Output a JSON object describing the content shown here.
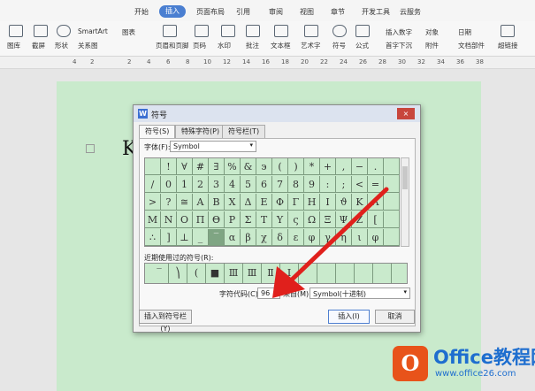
{
  "ribbon_tabs": [
    "开始",
    "插入",
    "页面布局",
    "引用",
    "审阅",
    "视图",
    "章节",
    "开发工具",
    "云服务"
  ],
  "ribbon_groups": {
    "picture": "图库",
    "screenshot": "截屏",
    "shapes": "形状",
    "smartart": "SmartArt",
    "relations": "关系图",
    "chart": "图表",
    "header_footer": "页眉和页脚",
    "page_number": "页码",
    "watermark": "水印",
    "comment": "批注",
    "textbox": "文本框",
    "wordart": "艺术字",
    "symbol": "符号",
    "formula": "公式",
    "insert_number": "插入数字",
    "first_drop": "首字下沉",
    "object": "对象",
    "attachment": "附件",
    "date": "日期",
    "doc_parts": "文档部件",
    "hyperlink": "超链接"
  },
  "ruler_numbers": [
    "4",
    "2",
    "2",
    "4",
    "6",
    "8",
    "10",
    "12",
    "14",
    "16",
    "18",
    "20",
    "22",
    "24",
    "26",
    "28",
    "30",
    "32",
    "34",
    "36",
    "38"
  ],
  "document": {
    "text": "K"
  },
  "dialog": {
    "title": "符号",
    "close_label": "×",
    "tabs": [
      "符号(S)",
      "特殊字符(P)",
      "符号栏(T)"
    ],
    "font_label": "字体(F):",
    "font_value": "Symbol",
    "grid_symbols": [
      [
        "",
        "!",
        "∀",
        "#",
        "∃",
        "%",
        "&",
        "϶",
        "(",
        ")",
        "*",
        "+",
        ",",
        "−",
        ".",
        ""
      ],
      [
        "/",
        "0",
        "1",
        "2",
        "3",
        "4",
        "5",
        "6",
        "7",
        "8",
        "9",
        ":",
        ";",
        "<",
        "=",
        ""
      ],
      [
        ">",
        "?",
        "≅",
        "Α",
        "Β",
        "Χ",
        "Δ",
        "Ε",
        "Φ",
        "Γ",
        "Η",
        "Ι",
        "ϑ",
        "Κ",
        "Λ",
        ""
      ],
      [
        "Μ",
        "Ν",
        "Ο",
        "Π",
        "Θ",
        "Ρ",
        "Σ",
        "Τ",
        "Υ",
        "ς",
        "Ω",
        "Ξ",
        "Ψ",
        "Ζ",
        "[",
        ""
      ],
      [
        "∴",
        "]",
        "⊥",
        "_",
        "‾",
        "α",
        "β",
        "χ",
        "δ",
        "ε",
        "φ",
        "γ",
        "η",
        "ι",
        "φ",
        ""
      ]
    ],
    "highlighted_cell": [
      4,
      4
    ],
    "recent_label": "近期使用过的符号(R):",
    "recent_symbols": [
      "‾",
      "⎞",
      "(",
      "■",
      "Ⅲ",
      "Ⅲ",
      "Ⅱ",
      "Ⅰ",
      "",
      "",
      "",
      "",
      "",
      "∄",
      "",
      "→",
      "•",
      "✂",
      "‰"
    ],
    "char_code_label": "字符代码(C):",
    "char_code_value": "96",
    "from_label": "来自(M)",
    "from_value": "Symbol(十进制)",
    "insert_to_bar_button": "插入到符号栏(Y)",
    "insert_button": "插入(I)",
    "cancel_button": "取消"
  },
  "watermark": {
    "logo_char": "O",
    "title": "Office教程网",
    "url": "www.office26.com"
  },
  "colors": {
    "accent": "#4a7fd1",
    "grid_bg": "#c9eacc",
    "arrow": "#e0201c",
    "logo_orange": "#e8531a",
    "logo_blue": "#1e6ecf"
  }
}
